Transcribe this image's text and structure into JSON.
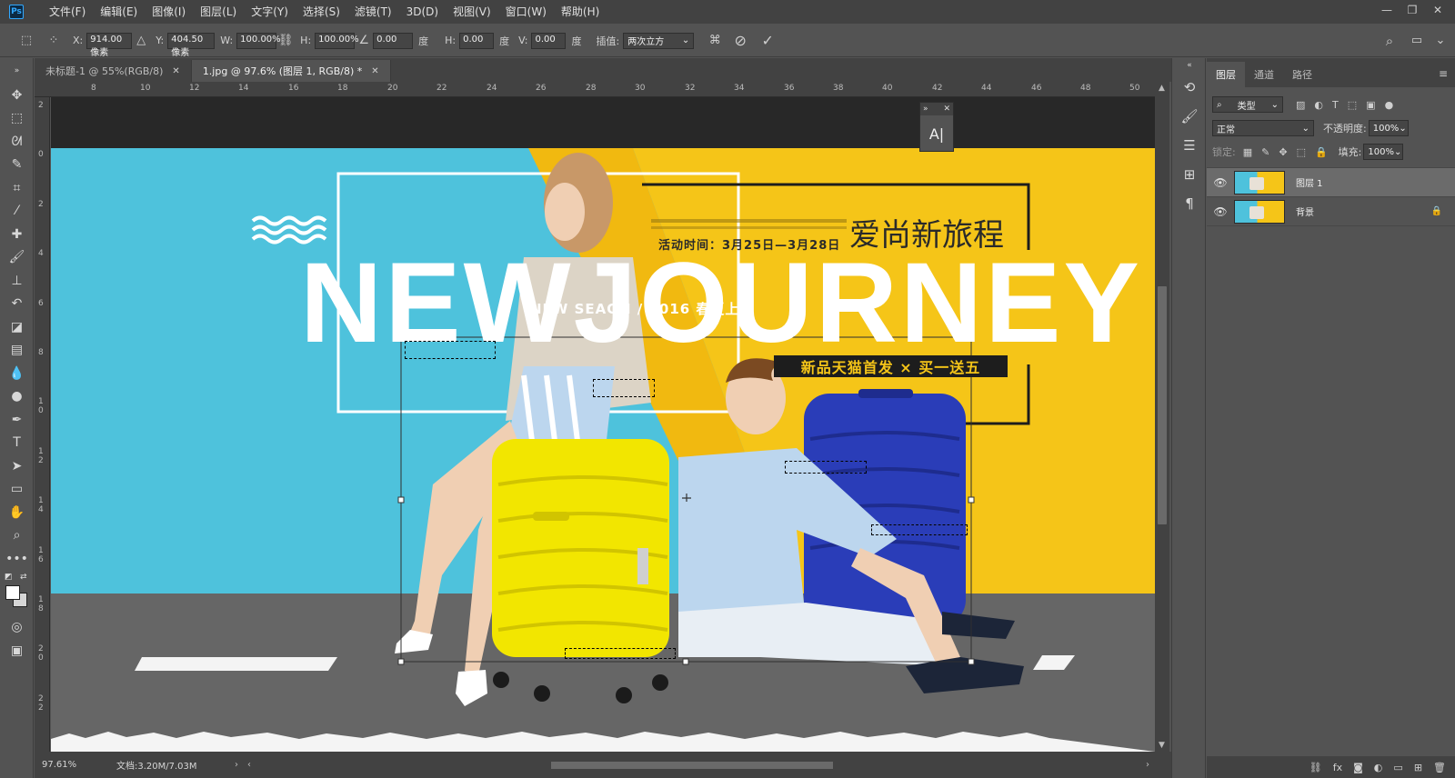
{
  "app": {
    "logo": "Ps"
  },
  "menu": [
    "文件(F)",
    "编辑(E)",
    "图像(I)",
    "图层(L)",
    "文字(Y)",
    "选择(S)",
    "滤镜(T)",
    "3D(D)",
    "视图(V)",
    "窗口(W)",
    "帮助(H)"
  ],
  "window_controls": [
    "minimize",
    "restore",
    "close"
  ],
  "options": {
    "x_label": "X:",
    "x_value": "914.00 像素",
    "y_label": "Y:",
    "y_value": "404.50 像素",
    "w_label": "W:",
    "w_value": "100.00%",
    "h_label": "H:",
    "h_value": "100.00%",
    "angle_value": "0.00",
    "deg": "度",
    "hskew_label": "H:",
    "hskew_value": "0.00",
    "vskew_label": "V:",
    "vskew_value": "0.00",
    "interp_label": "插值:",
    "interp_value": "两次立方"
  },
  "tabs": [
    {
      "label": "未标题-1 @ 55%(RGB/8)",
      "active": false
    },
    {
      "label": "1.jpg @ 97.6% (图层 1, RGB/8) *",
      "active": true
    }
  ],
  "ruler_h": [
    "8",
    "10",
    "12",
    "14",
    "16",
    "18",
    "20",
    "22",
    "24",
    "26",
    "28",
    "30",
    "32",
    "34",
    "36",
    "38",
    "40",
    "42",
    "44",
    "46",
    "48",
    "50"
  ],
  "ruler_v": [
    "2",
    "0",
    "2",
    "4",
    "6",
    "8",
    "1 0",
    "1 2",
    "1 4",
    "1 6",
    "1 8",
    "2 0",
    "2 2"
  ],
  "artwork": {
    "headline": "NEWJOURNEY",
    "subtitle": "NEW SEAON / 2016 春夏上新",
    "cn_title": "爱尚新旅程",
    "date": "活动时间：3月25日—3月28日",
    "promo": "新品天猫首发 × 买一送五"
  },
  "mini_panel": {
    "glyph": "A|"
  },
  "status": {
    "zoom": "97.61%",
    "doc": "文档:3.20M/7.03M"
  },
  "layers_panel": {
    "tabs": [
      "图层",
      "通道",
      "路径"
    ],
    "filter_label": "类型",
    "blend_mode": "正常",
    "opacity_label": "不透明度:",
    "opacity_value": "100%",
    "lock_label": "锁定:",
    "fill_label": "填充:",
    "fill_value": "100%",
    "layers": [
      {
        "name": "图层 1",
        "selected": true,
        "locked": false
      },
      {
        "name": "背景",
        "selected": false,
        "locked": true
      }
    ]
  },
  "colors": {
    "sky": "#4ec2dc",
    "yellow": "#f5c518",
    "floor": "#666666",
    "suitcase_yellow": "#f2e600",
    "suitcase_blue": "#2a3db8"
  }
}
